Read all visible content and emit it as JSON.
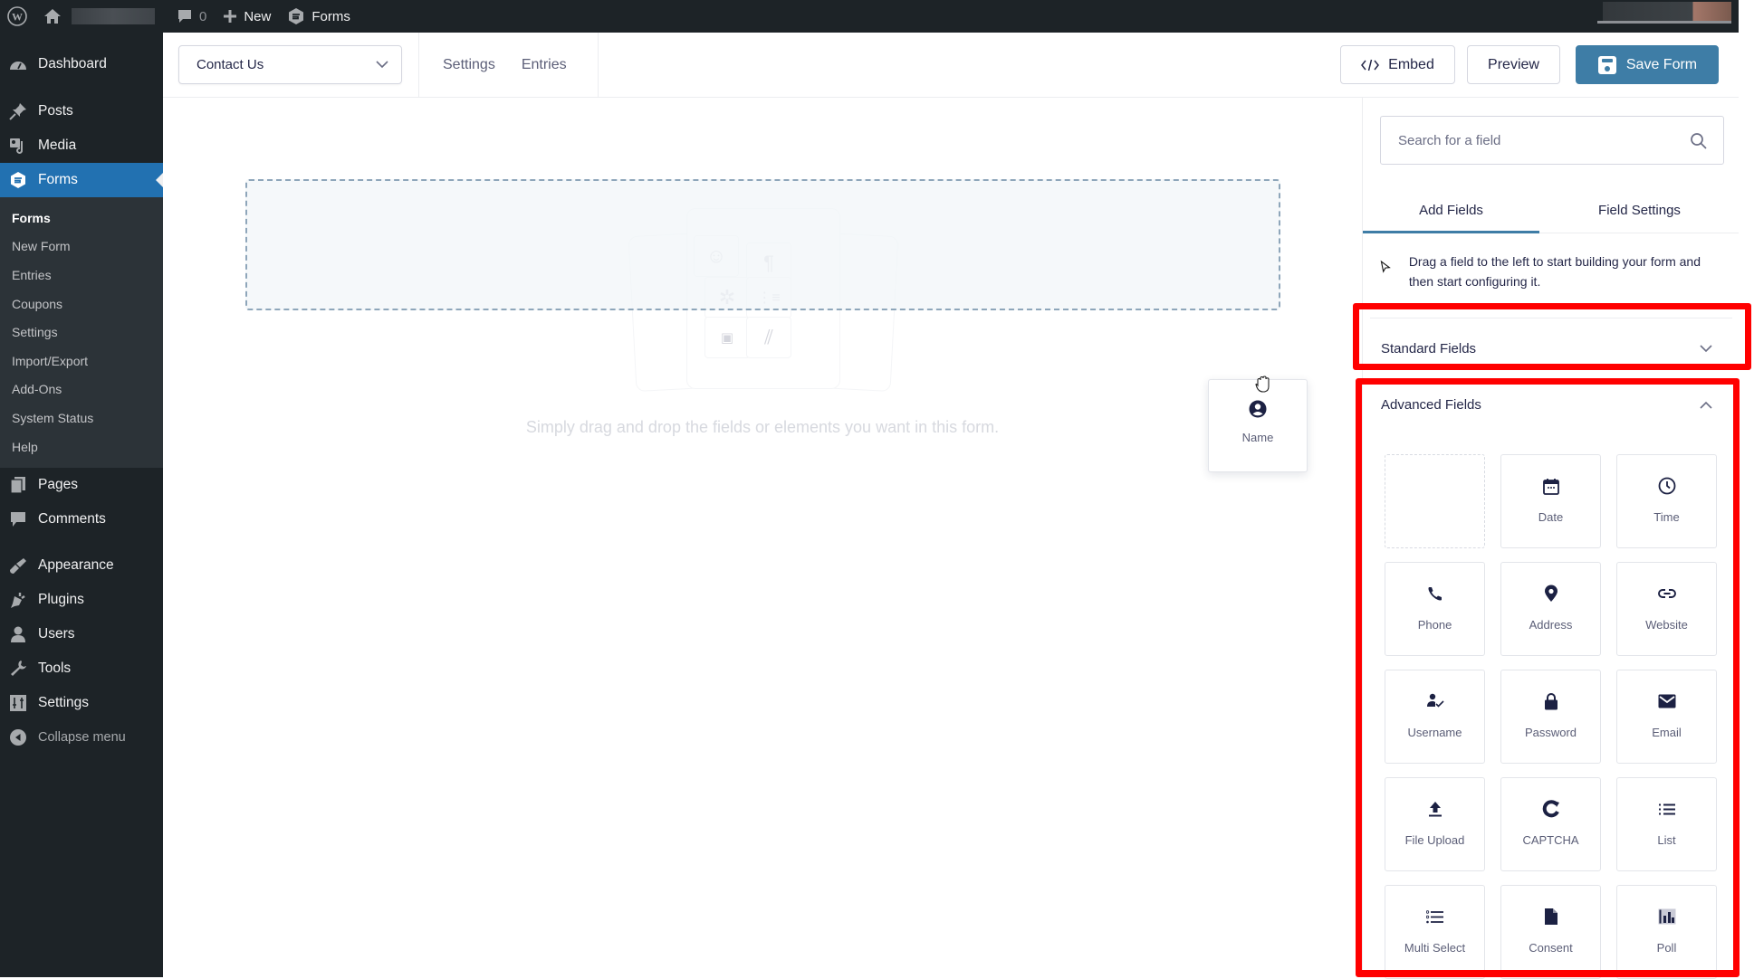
{
  "adminbar": {
    "comment_count": "0",
    "new_label": "New",
    "forms_label": "Forms"
  },
  "menu": {
    "top_items": [
      {
        "label": "Dashboard",
        "icon": "dashboard-icon"
      },
      {
        "label": "Posts",
        "icon": "pin-icon"
      },
      {
        "label": "Media",
        "icon": "media-icon"
      },
      {
        "label": "Forms",
        "icon": "gravity-forms-icon"
      }
    ],
    "forms_submenu": [
      "Forms",
      "New Form",
      "Entries",
      "Coupons",
      "Settings",
      "Import/Export",
      "Add-Ons",
      "System Status",
      "Help"
    ],
    "mid_items": [
      {
        "label": "Pages",
        "icon": "pages-icon"
      },
      {
        "label": "Comments",
        "icon": "comment-icon"
      }
    ],
    "bottom_items": [
      {
        "label": "Appearance",
        "icon": "brush-icon"
      },
      {
        "label": "Plugins",
        "icon": "plugin-icon"
      },
      {
        "label": "Users",
        "icon": "user-icon"
      },
      {
        "label": "Tools",
        "icon": "wrench-icon"
      },
      {
        "label": "Settings",
        "icon": "sliders-icon"
      }
    ],
    "collapse_label": "Collapse menu"
  },
  "toolbar": {
    "form_selected": "Contact Us",
    "links": [
      "Settings",
      "Entries"
    ],
    "embed_label": "Embed",
    "preview_label": "Preview",
    "save_label": "Save Form",
    "accent": "#3e7da6"
  },
  "canvas": {
    "hint": "Simply drag and drop the fields or elements you want in this form.",
    "dragging_field": "Name"
  },
  "panel": {
    "search_placeholder": "Search for a field",
    "tabs": [
      "Add Fields",
      "Field Settings"
    ],
    "active_tab": "Add Fields",
    "hint": "Drag a field to the left to start building your form and then start configuring it.",
    "standard_section": "Standard Fields",
    "advanced_section": "Advanced Fields",
    "highlight_color": "#ff0000",
    "advanced_fields": [
      {
        "label": "",
        "icon": "placeholder"
      },
      {
        "label": "Date",
        "icon": "calendar-icon"
      },
      {
        "label": "Time",
        "icon": "clock-icon"
      },
      {
        "label": "Phone",
        "icon": "phone-icon"
      },
      {
        "label": "Address",
        "icon": "map-pin-icon"
      },
      {
        "label": "Website",
        "icon": "link-icon"
      },
      {
        "label": "Username",
        "icon": "user-check-icon"
      },
      {
        "label": "Password",
        "icon": "lock-icon"
      },
      {
        "label": "Email",
        "icon": "envelope-icon"
      },
      {
        "label": "File Upload",
        "icon": "upload-icon"
      },
      {
        "label": "CAPTCHA",
        "icon": "captcha-icon"
      },
      {
        "label": "List",
        "icon": "list-icon"
      },
      {
        "label": "Multi Select",
        "icon": "multi-select-icon"
      },
      {
        "label": "Consent",
        "icon": "document-icon"
      },
      {
        "label": "Poll",
        "icon": "poll-icon"
      }
    ]
  }
}
